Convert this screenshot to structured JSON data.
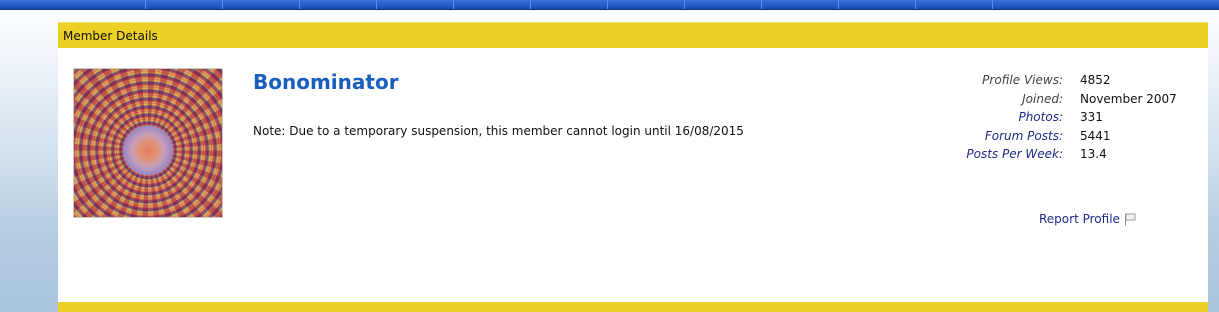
{
  "panel": {
    "header_title": "Member Details"
  },
  "member": {
    "name": "Bonominator",
    "note": "Note: Due to a temporary suspension, this member cannot login until 16/08/2015"
  },
  "stats": [
    {
      "label": "Profile Views:",
      "value": "4852",
      "link": false
    },
    {
      "label": "Joined:",
      "value": "November 2007",
      "link": false
    },
    {
      "label": "Photos:",
      "value": "331",
      "link": true
    },
    {
      "label": "Forum Posts:",
      "value": "5441",
      "link": true
    },
    {
      "label": "Posts Per Week:",
      "value": "13.4",
      "link": true
    }
  ],
  "actions": {
    "report_profile": "Report Profile",
    "report_icon": "flag-icon"
  },
  "colors": {
    "nav_blue": "#1f56c4",
    "header_yellow": "#ecd025",
    "name_blue": "#1a5fbf",
    "link_navy": "#1e2a8a"
  }
}
